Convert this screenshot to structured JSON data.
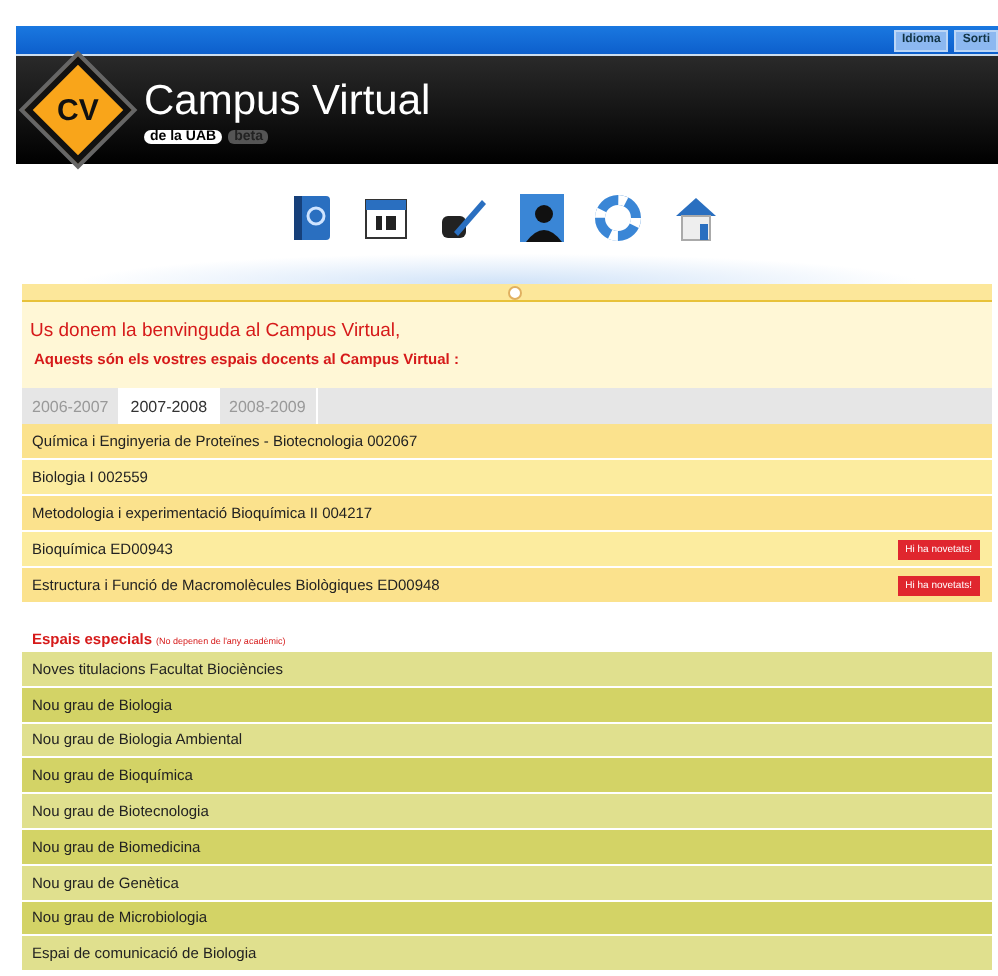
{
  "top_bar": {
    "buttons": [
      "Idioma",
      "Sorti"
    ]
  },
  "header": {
    "logo_mark": "CV",
    "title": "Campus Virtual",
    "subtitle": "de la UAB",
    "tag": "beta"
  },
  "welcome": {
    "greeting": "Us donem la benvinguda al Campus Virtual,",
    "heading": "Aquests són els vostres espais docents al Campus Virtual :"
  },
  "tabs": [
    {
      "label": "2006-2007",
      "selected": false
    },
    {
      "label": "2007-2008",
      "selected": true
    },
    {
      "label": "2008-2009",
      "selected": false
    }
  ],
  "courses": [
    {
      "name": "Química i Enginyeria de Proteïnes - Biotecnologia 002067"
    },
    {
      "name": "Biologia I 002559"
    },
    {
      "name": "Metodologia i experimentació Bioquímica II 004217"
    },
    {
      "name": "Bioquímica ED00943",
      "badge": "Hi ha novetats!"
    },
    {
      "name": "Estructura i Funció de Macromolècules Biològiques ED00948",
      "badge": "Hi ha novetats!"
    }
  ],
  "special": {
    "title": "Espais especials",
    "note": "(No depenen de l'any acadèmic)",
    "items": [
      "Noves titulacions Facultat Biociències",
      "Nou grau de Biologia",
      "Nou grau de Biologia Ambiental",
      "Nou grau de Bioquímica",
      "Nou grau de Biotecnologia",
      "Nou grau de Biomedicina",
      "Nou grau de Genètica",
      "Nou grau de Microbiologia",
      "Espai de comunicació de Biologia"
    ]
  }
}
